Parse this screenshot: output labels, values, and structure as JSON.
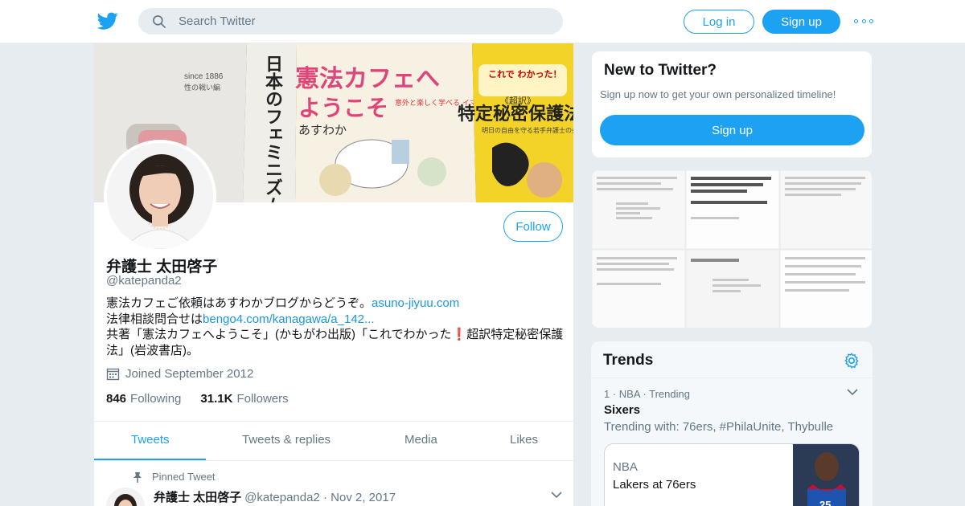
{
  "nav": {
    "search_placeholder": "Search Twitter",
    "login_label": "Log in",
    "signup_label": "Sign up"
  },
  "profile": {
    "follow_label": "Follow",
    "name": "弁護士 太田啓子",
    "handle": "@katepanda2",
    "bio_line1_text": "憲法カフェご依頼はあすわかブログからどうぞ。",
    "bio_line1_link": "asuno-jiyuu.com",
    "bio_line2_text": "法律相談問合せは",
    "bio_line2_link": "bengo4.com/kanagawa/a_142...",
    "bio_line3": "共著「憲法カフェへようこそ」(かもがわ出版)「これでわかった",
    "bio_line3_emoji": "❗",
    "bio_line3_end": "超訳特定秘密保護法」(岩波書店)。",
    "joined": "Joined September 2012",
    "following_count": "846",
    "following_label": "Following",
    "followers_count": "31.1K",
    "followers_label": "Followers"
  },
  "tabs": [
    "Tweets",
    "Tweets & replies",
    "Media",
    "Likes"
  ],
  "pinned": {
    "label": "Pinned Tweet",
    "name": "弁護士 太田啓子",
    "handle": "@katepanda2",
    "date": "Nov 2, 2017"
  },
  "newbox": {
    "title": "New to Twitter?",
    "subtitle": "Sign up now to get your own personalized timeline!",
    "signup_label": "Sign up"
  },
  "trends": {
    "title": "Trends",
    "item": {
      "meta": "1 · NBA · Trending",
      "name": "Sixers",
      "with": "Trending with: 76ers, #PhilaUnite, Thybulle"
    },
    "card": {
      "category": "NBA",
      "title": "Lakers at 76ers"
    }
  },
  "banner": {
    "book1_since": "since 1886",
    "book1_sub": "性の戦い編",
    "book2_title": "日本のフェミニズム",
    "book3_title1": "憲法カフェへ",
    "book3_title2": "ようこそ",
    "book3_tag": "意外と楽しく学べる イマドキの改憲",
    "book3_author": "あすわか",
    "book4_top": "これで わかった！",
    "book4_mid": "《超訳》",
    "book4_title": "特定秘密保護法",
    "book4_sub": "明日の自由を守る若手弁護士の会"
  },
  "colors": {
    "accent": "#1da1f2",
    "link": "#1b95e0",
    "muted": "#657786",
    "background": "#e6ecf0"
  }
}
